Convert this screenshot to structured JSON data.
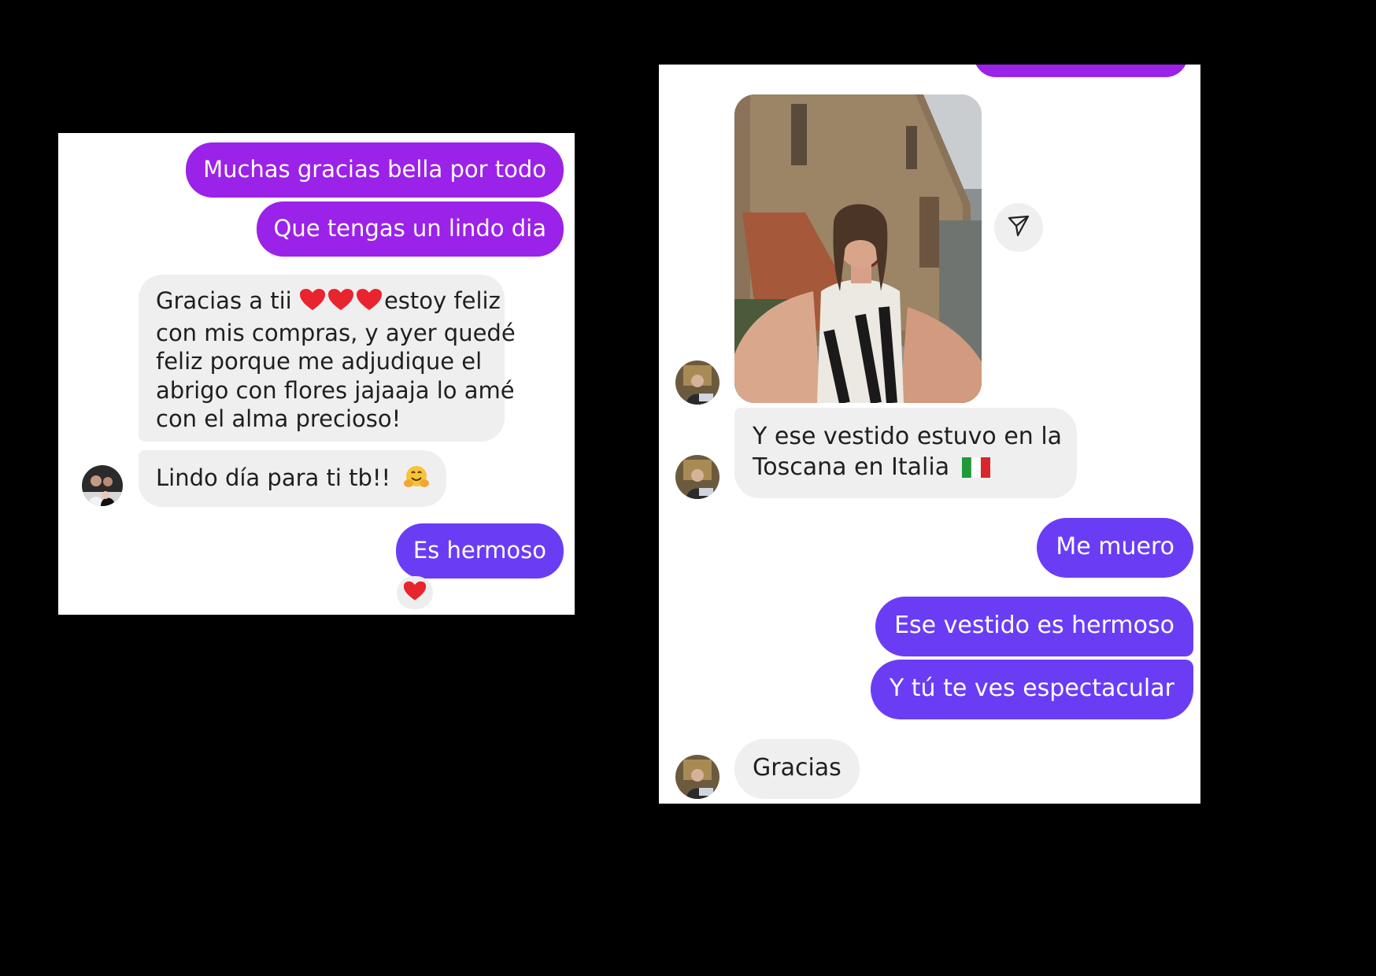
{
  "left_chat": {
    "messages": [
      {
        "from": "me",
        "text": "Muchas gracias bella por todo"
      },
      {
        "from": "me",
        "text": "Que tengas un lindo dia"
      },
      {
        "from": "them",
        "lines": [
          "Gracias a tii",
          "estoy feliz",
          "con mis compras, y ayer quedé",
          "feliz porque me adjudique el",
          "abrigo con flores jajaaja lo amé",
          "con el alma precioso!"
        ]
      },
      {
        "from": "them",
        "text": "Lindo día para ti tb!!"
      },
      {
        "from": "me",
        "text": "Es hermoso",
        "reaction": "red-heart"
      }
    ]
  },
  "right_chat": {
    "messages": [
      {
        "from": "them",
        "type": "photo",
        "share_icon": "send-icon"
      },
      {
        "from": "them",
        "lines": [
          "Y ese vestido estuvo en la",
          "Toscana en Italia"
        ]
      },
      {
        "from": "me",
        "text": "Me muero"
      },
      {
        "from": "me",
        "text": "Ese vestido es hermoso"
      },
      {
        "from": "me",
        "text": "Y tú te ves espectacular"
      },
      {
        "from": "them",
        "text": "Gracias"
      }
    ]
  },
  "colors": {
    "sent_left": "#9b22e8",
    "sent_right": "#6a3df5",
    "received": "#efefef",
    "background": "#000000"
  }
}
